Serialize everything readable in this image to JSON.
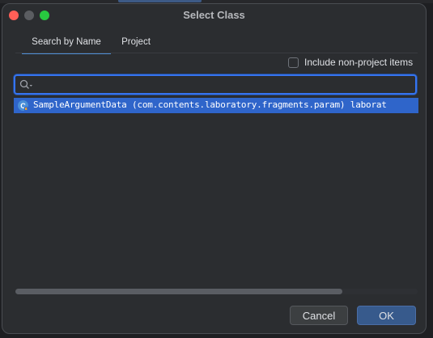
{
  "window": {
    "title": "Select Class"
  },
  "tabs": [
    {
      "label": "Search by Name",
      "active": true
    },
    {
      "label": "Project",
      "active": false
    }
  ],
  "options": {
    "include_non_project_label": "Include non-project items",
    "include_non_project_checked": false
  },
  "search": {
    "value": "",
    "placeholder": ""
  },
  "results": [
    {
      "text": "SampleArgumentData (com.contents.laboratory.fragments.param) laborat",
      "icon": "kotlin-class-icon",
      "selected": true
    }
  ],
  "buttons": {
    "cancel_label": "Cancel",
    "ok_label": "OK"
  },
  "colors": {
    "accent": "#3574f0",
    "selection": "#2f65ca",
    "ok_button": "#375a8c",
    "background": "#2b2d30"
  }
}
